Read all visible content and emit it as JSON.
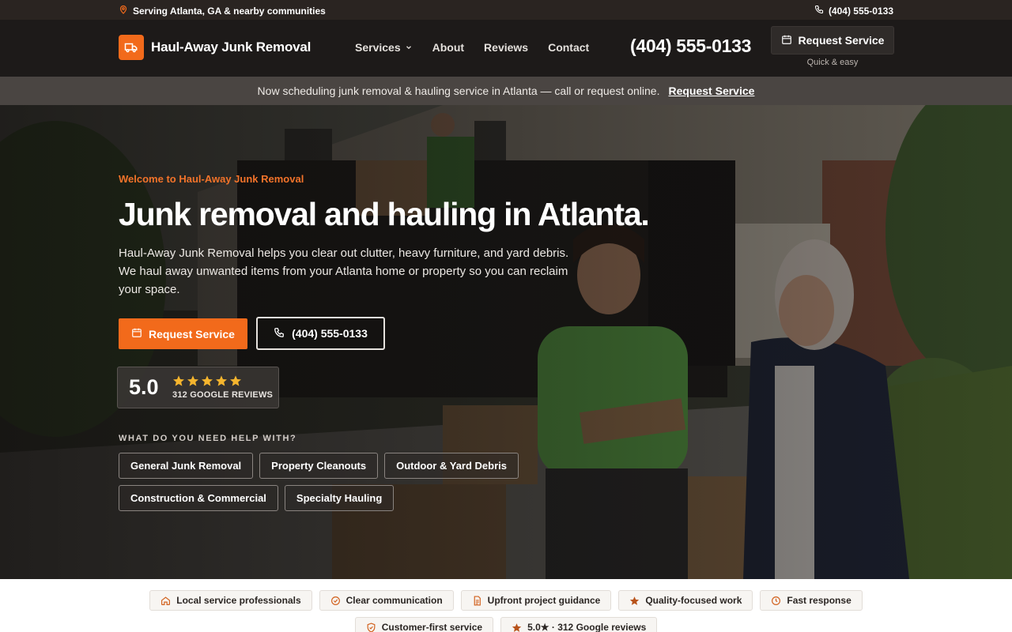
{
  "topbar": {
    "location": "Serving Atlanta, GA & nearby communities",
    "phone": "(404) 555-0133"
  },
  "header": {
    "logo_text": "Haul-Away Junk Removal",
    "nav": [
      {
        "label": "Services"
      },
      {
        "label": "About"
      },
      {
        "label": "Reviews"
      },
      {
        "label": "Contact"
      }
    ],
    "phone": "(404) 555-0133",
    "cta_label": "Request Service",
    "cta_sub": "Quick & easy"
  },
  "announcement": {
    "text": "Now scheduling junk removal & hauling service in Atlanta — call or request online.",
    "link": "Request Service"
  },
  "hero": {
    "eyebrow": "Welcome to Haul-Away Junk Removal",
    "title": "Junk removal and hauling in Atlanta.",
    "lead": "Haul-Away Junk Removal helps you clear out clutter, heavy furniture, and yard debris. We haul away unwanted items from your Atlanta home or property so you can reclaim your space.",
    "primary_cta": "Request Service",
    "secondary_cta": "(404) 555-0133",
    "rating": {
      "score": "5.0",
      "stars": 5,
      "count_label": "312 GOOGLE REVIEWS"
    },
    "help_label": "WHAT DO YOU NEED HELP WITH?",
    "chips": [
      "General Junk Removal",
      "Property Cleanouts",
      "Outdoor & Yard Debris",
      "Construction & Commercial",
      "Specialty Hauling"
    ]
  },
  "trust": {
    "row1": [
      {
        "label": "Local service professionals",
        "icon": "home-icon"
      },
      {
        "label": "Clear communication",
        "icon": "check-circle-icon"
      },
      {
        "label": "Upfront project guidance",
        "icon": "document-icon"
      },
      {
        "label": "Quality-focused work",
        "icon": "star-icon"
      },
      {
        "label": "Fast response",
        "icon": "clock-icon"
      }
    ],
    "row2": [
      {
        "label": "Customer-first service",
        "icon": "shield-check-icon"
      },
      {
        "label": "5.0★ · 312 Google reviews",
        "icon": "star-icon"
      }
    ]
  },
  "colors": {
    "accent": "#f26a1b",
    "header_bg": "#1d1a19",
    "topbar_bg": "#2a2421",
    "announce_bg": "#4a4542",
    "star": "#f5b52e"
  }
}
